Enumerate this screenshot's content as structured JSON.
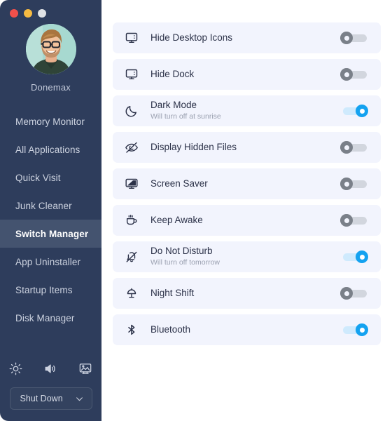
{
  "window": {
    "traffic_lights": [
      {
        "name": "close-button",
        "color": "#f2504b"
      },
      {
        "name": "minimize-button",
        "color": "#f6bb42"
      },
      {
        "name": "maximize-button",
        "color": "#dfe2e5"
      }
    ]
  },
  "sidebar": {
    "profile": {
      "name": "Donemax",
      "avatar_icon": "user-avatar-photo"
    },
    "items": [
      {
        "label": "Memory Monitor",
        "active": false
      },
      {
        "label": "All Applications",
        "active": false
      },
      {
        "label": "Quick Visit",
        "active": false
      },
      {
        "label": "Junk Cleaner",
        "active": false
      },
      {
        "label": "Switch Manager",
        "active": true
      },
      {
        "label": "App Uninstaller",
        "active": false
      },
      {
        "label": "Startup Items",
        "active": false
      },
      {
        "label": "Disk Manager",
        "active": false
      }
    ],
    "quick_icons": [
      {
        "name": "brightness-icon"
      },
      {
        "name": "volume-icon"
      },
      {
        "name": "display-wallpaper-icon"
      }
    ],
    "shutdown": {
      "label": "Shut Down",
      "chevron_icon": "chevron-down-icon"
    },
    "colors": {
      "background": "#2e3d5c",
      "active_item": "#44536f",
      "text": "#cdd3e0"
    }
  },
  "main": {
    "rows": [
      {
        "title": "Hide Desktop Icons",
        "subtitle": "",
        "icon": "monitor-dots-icon",
        "enabled": false
      },
      {
        "title": "Hide Dock",
        "subtitle": "",
        "icon": "monitor-dots-icon",
        "enabled": false
      },
      {
        "title": "Dark Mode",
        "subtitle": "Will turn off at sunrise",
        "icon": "moon-icon",
        "enabled": true
      },
      {
        "title": "Display Hidden Files",
        "subtitle": "",
        "icon": "eye-slash-icon",
        "enabled": false
      },
      {
        "title": "Screen Saver",
        "subtitle": "",
        "icon": "monitor-filled-icon",
        "enabled": false
      },
      {
        "title": "Keep Awake",
        "subtitle": "",
        "icon": "coffee-cup-icon",
        "enabled": false
      },
      {
        "title": "Do Not Disturb",
        "subtitle": "Will turn off tomorrow",
        "icon": "bell-slash-icon",
        "enabled": true
      },
      {
        "title": "Night Shift",
        "subtitle": "",
        "icon": "desk-lamp-icon",
        "enabled": false
      },
      {
        "title": "Bluetooth",
        "subtitle": "",
        "icon": "bluetooth-icon",
        "enabled": true
      }
    ],
    "colors": {
      "row_background": "#f2f4fd",
      "toggle_on": "#14a2f0",
      "toggle_off": "#7a8089",
      "title_text": "#2b3148",
      "subtitle_text": "#9aa0b0"
    }
  }
}
